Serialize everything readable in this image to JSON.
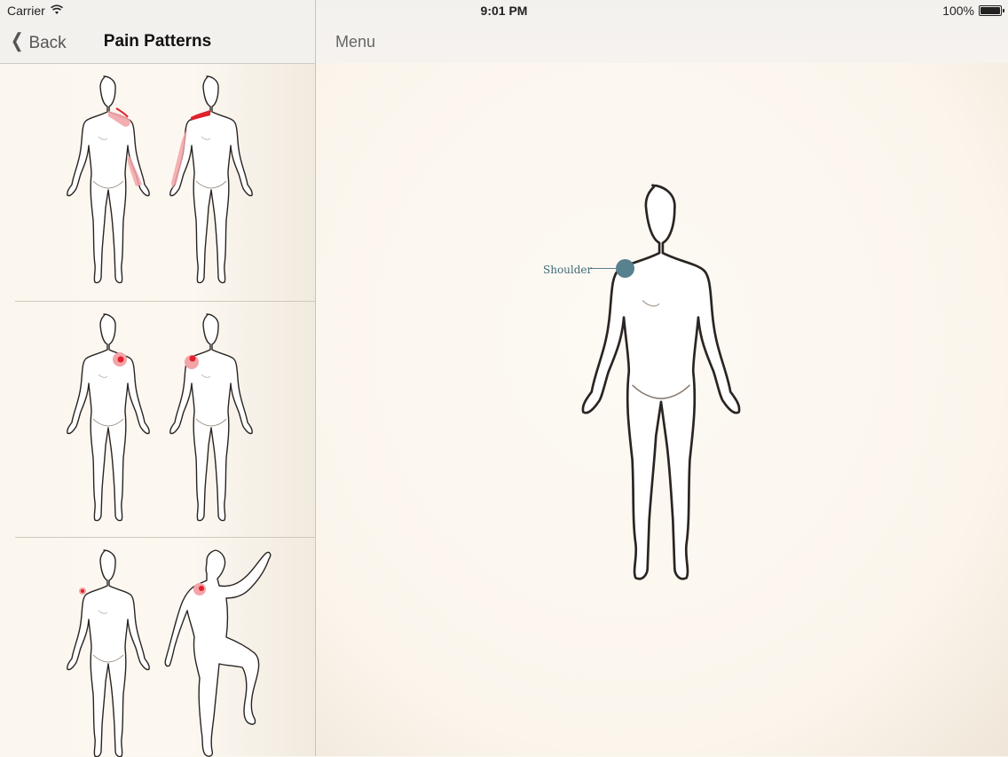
{
  "status_bar": {
    "carrier": "Carrier",
    "time": "9:01 PM",
    "battery": "100%"
  },
  "left_panel": {
    "back_label": "Back",
    "title": "Pain Patterns",
    "patterns": [
      {
        "views": [
          "back",
          "front"
        ]
      },
      {
        "views": [
          "back",
          "front"
        ]
      },
      {
        "views": [
          "front",
          "side-raised-arm"
        ]
      }
    ]
  },
  "right_panel": {
    "menu_label": "Menu",
    "marker_label": "Shoulder"
  },
  "colors": {
    "pain_red": "#e0202a",
    "pain_pink": "#f3a4a8",
    "marker": "#57818f"
  }
}
